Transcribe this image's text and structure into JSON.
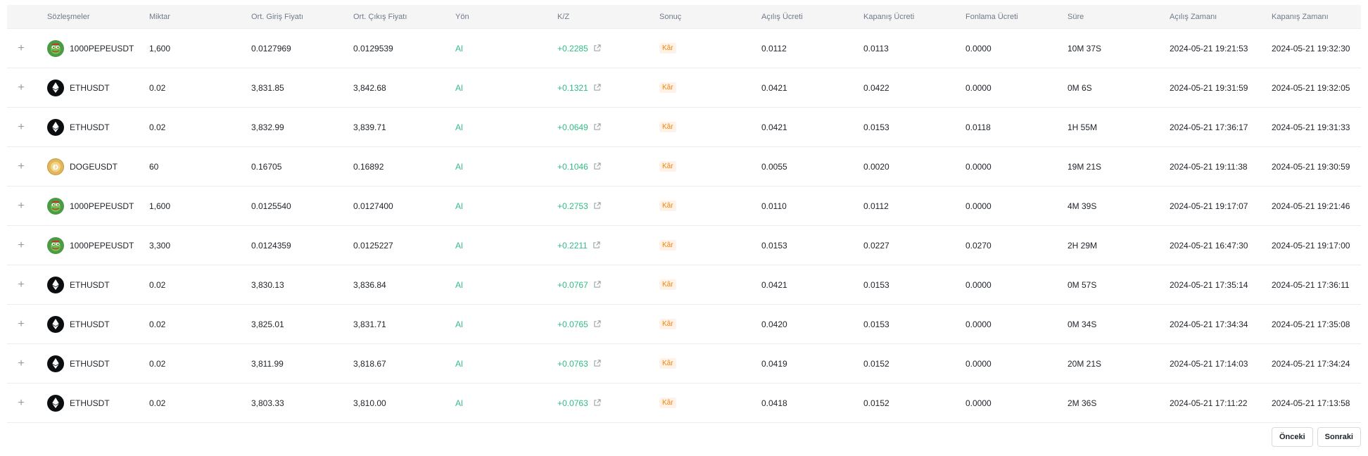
{
  "columns": [
    "Sözleşmeler",
    "Miktar",
    "Ort. Giriş Fiyatı",
    "Ort. Çıkış Fiyatı",
    "Yön",
    "K/Z",
    "Sonuç",
    "Açılış Ücreti",
    "Kapanış Ücreti",
    "Fonlama Ücreti",
    "Süre",
    "Açılış Zamanı",
    "Kapanış Zamanı"
  ],
  "expand_symbol": "+",
  "colors": {
    "positive": "#2ebd85",
    "badge_text": "#f0850d",
    "badge_bg": "#fff1e6",
    "header_bg": "#f5f5f5"
  },
  "rows": [
    {
      "coin": "pepe",
      "icon": "pepe-coin-icon",
      "symbol": "1000PEPEUSDT",
      "qty": "1,600",
      "entry": "0.0127969",
      "exit": "0.0129539",
      "side": "Al",
      "pnl": "+0.2285",
      "result": "Kâr",
      "open_fee": "0.0112",
      "close_fee": "0.0113",
      "funding_fee": "0.0000",
      "duration": "10M 37S",
      "open_time": "2024-05-21 19:21:53",
      "close_time": "2024-05-21 19:32:30"
    },
    {
      "coin": "eth",
      "icon": "eth-coin-icon",
      "symbol": "ETHUSDT",
      "qty": "0.02",
      "entry": "3,831.85",
      "exit": "3,842.68",
      "side": "Al",
      "pnl": "+0.1321",
      "result": "Kâr",
      "open_fee": "0.0421",
      "close_fee": "0.0422",
      "funding_fee": "0.0000",
      "duration": "0M 6S",
      "open_time": "2024-05-21 19:31:59",
      "close_time": "2024-05-21 19:32:05"
    },
    {
      "coin": "eth",
      "icon": "eth-coin-icon",
      "symbol": "ETHUSDT",
      "qty": "0.02",
      "entry": "3,832.99",
      "exit": "3,839.71",
      "side": "Al",
      "pnl": "+0.0649",
      "result": "Kâr",
      "open_fee": "0.0421",
      "close_fee": "0.0153",
      "funding_fee": "0.0118",
      "duration": "1H 55M",
      "open_time": "2024-05-21 17:36:17",
      "close_time": "2024-05-21 19:31:33"
    },
    {
      "coin": "doge",
      "icon": "doge-coin-icon",
      "symbol": "DOGEUSDT",
      "qty": "60",
      "entry": "0.16705",
      "exit": "0.16892",
      "side": "Al",
      "pnl": "+0.1046",
      "result": "Kâr",
      "open_fee": "0.0055",
      "close_fee": "0.0020",
      "funding_fee": "0.0000",
      "duration": "19M 21S",
      "open_time": "2024-05-21 19:11:38",
      "close_time": "2024-05-21 19:30:59"
    },
    {
      "coin": "pepe",
      "icon": "pepe-coin-icon",
      "symbol": "1000PEPEUSDT",
      "qty": "1,600",
      "entry": "0.0125540",
      "exit": "0.0127400",
      "side": "Al",
      "pnl": "+0.2753",
      "result": "Kâr",
      "open_fee": "0.0110",
      "close_fee": "0.0112",
      "funding_fee": "0.0000",
      "duration": "4M 39S",
      "open_time": "2024-05-21 19:17:07",
      "close_time": "2024-05-21 19:21:46"
    },
    {
      "coin": "pepe",
      "icon": "pepe-coin-icon",
      "symbol": "1000PEPEUSDT",
      "qty": "3,300",
      "entry": "0.0124359",
      "exit": "0.0125227",
      "side": "Al",
      "pnl": "+0.2211",
      "result": "Kâr",
      "open_fee": "0.0153",
      "close_fee": "0.0227",
      "funding_fee": "0.0270",
      "duration": "2H 29M",
      "open_time": "2024-05-21 16:47:30",
      "close_time": "2024-05-21 19:17:00"
    },
    {
      "coin": "eth",
      "icon": "eth-coin-icon",
      "symbol": "ETHUSDT",
      "qty": "0.02",
      "entry": "3,830.13",
      "exit": "3,836.84",
      "side": "Al",
      "pnl": "+0.0767",
      "result": "Kâr",
      "open_fee": "0.0421",
      "close_fee": "0.0153",
      "funding_fee": "0.0000",
      "duration": "0M 57S",
      "open_time": "2024-05-21 17:35:14",
      "close_time": "2024-05-21 17:36:11"
    },
    {
      "coin": "eth",
      "icon": "eth-coin-icon",
      "symbol": "ETHUSDT",
      "qty": "0.02",
      "entry": "3,825.01",
      "exit": "3,831.71",
      "side": "Al",
      "pnl": "+0.0765",
      "result": "Kâr",
      "open_fee": "0.0420",
      "close_fee": "0.0153",
      "funding_fee": "0.0000",
      "duration": "0M 34S",
      "open_time": "2024-05-21 17:34:34",
      "close_time": "2024-05-21 17:35:08"
    },
    {
      "coin": "eth",
      "icon": "eth-coin-icon",
      "symbol": "ETHUSDT",
      "qty": "0.02",
      "entry": "3,811.99",
      "exit": "3,818.67",
      "side": "Al",
      "pnl": "+0.0763",
      "result": "Kâr",
      "open_fee": "0.0419",
      "close_fee": "0.0152",
      "funding_fee": "0.0000",
      "duration": "20M 21S",
      "open_time": "2024-05-21 17:14:03",
      "close_time": "2024-05-21 17:34:24"
    },
    {
      "coin": "eth",
      "icon": "eth-coin-icon",
      "symbol": "ETHUSDT",
      "qty": "0.02",
      "entry": "3,803.33",
      "exit": "3,810.00",
      "side": "Al",
      "pnl": "+0.0763",
      "result": "Kâr",
      "open_fee": "0.0418",
      "close_fee": "0.0152",
      "funding_fee": "0.0000",
      "duration": "2M 36S",
      "open_time": "2024-05-21 17:11:22",
      "close_time": "2024-05-21 17:13:58"
    }
  ],
  "pagination": {
    "prev_label": "Önceki",
    "next_label": "Sonraki"
  }
}
